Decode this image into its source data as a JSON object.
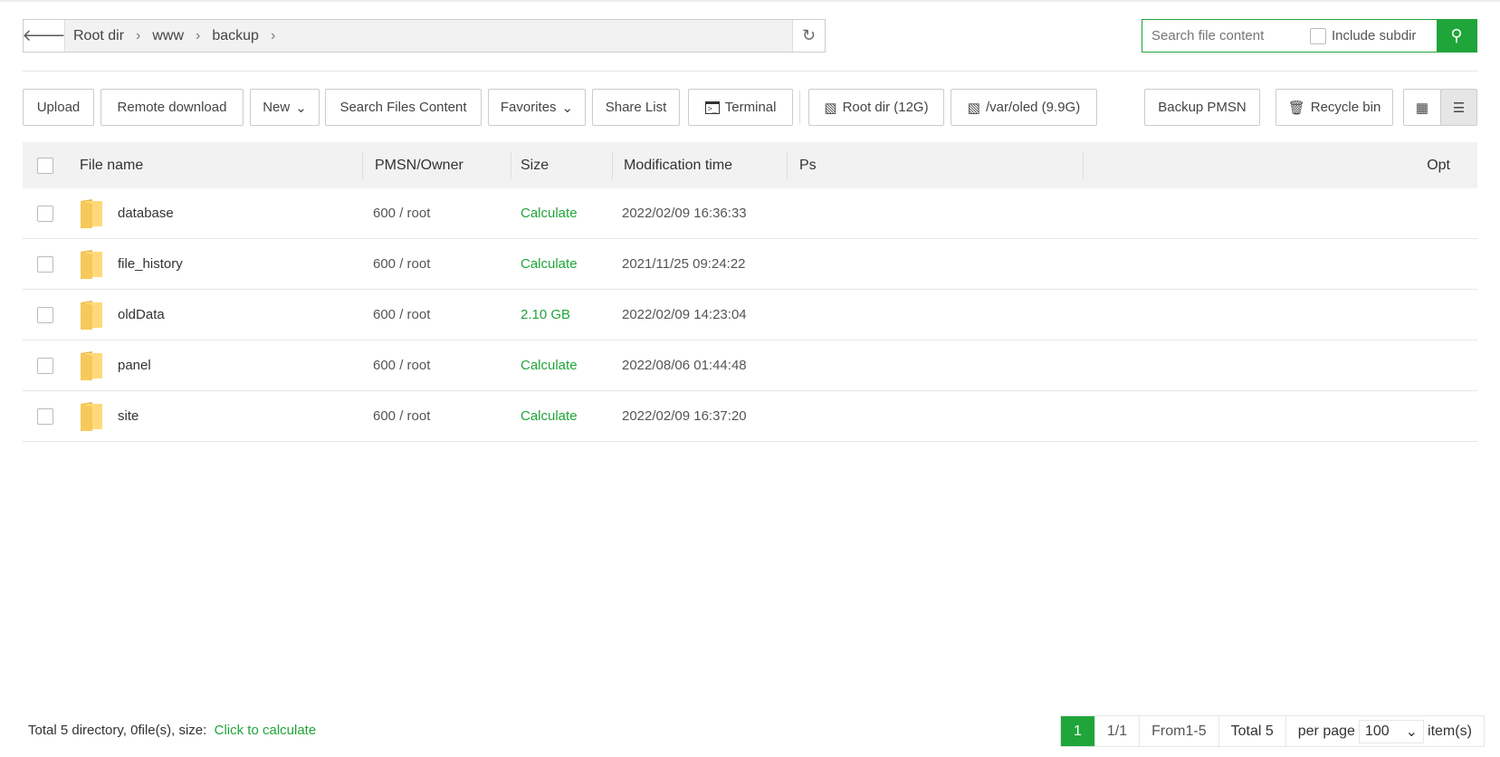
{
  "path": {
    "crumbs": [
      "Root dir",
      "www",
      "backup"
    ]
  },
  "search": {
    "placeholder": "Search file content",
    "include_subdir": "Include subdir"
  },
  "toolbar": {
    "upload": "Upload",
    "remote_download": "Remote download",
    "new": "New",
    "search_files": "Search Files Content",
    "favorites": "Favorites",
    "share_list": "Share List",
    "terminal": "Terminal",
    "disk1": "Root dir (12G)",
    "disk2": "/var/oled (9.9G)",
    "backup": "Backup PMSN",
    "recycle": "Recycle bin"
  },
  "table": {
    "headers": {
      "name": "File name",
      "owner": "PMSN/Owner",
      "size": "Size",
      "time": "Modification time",
      "ps": "Ps",
      "opt": "Opt"
    },
    "rows": [
      {
        "name": "database",
        "owner": "600 / root",
        "size": "Calculate",
        "time": "2022/02/09 16:36:33"
      },
      {
        "name": "file_history",
        "owner": "600 / root",
        "size": "Calculate",
        "time": "2021/11/25 09:24:22"
      },
      {
        "name": "oldData",
        "owner": "600 / root",
        "size": "2.10 GB",
        "time": "2022/02/09 14:23:04"
      },
      {
        "name": "panel",
        "owner": "600 / root",
        "size": "Calculate",
        "time": "2022/08/06 01:44:48"
      },
      {
        "name": "site",
        "owner": "600 / root",
        "size": "Calculate",
        "time": "2022/02/09 16:37:20"
      }
    ]
  },
  "footer": {
    "summary": "Total 5 directory, 0file(s), size:",
    "calc": "Click to calculate"
  },
  "pager": {
    "current": "1",
    "pages": "1/1",
    "range": "From1-5",
    "total": "Total 5",
    "per_page": "per page",
    "per_value": "100",
    "items": "item(s)"
  },
  "colors": {
    "accent": "#20a53a"
  }
}
